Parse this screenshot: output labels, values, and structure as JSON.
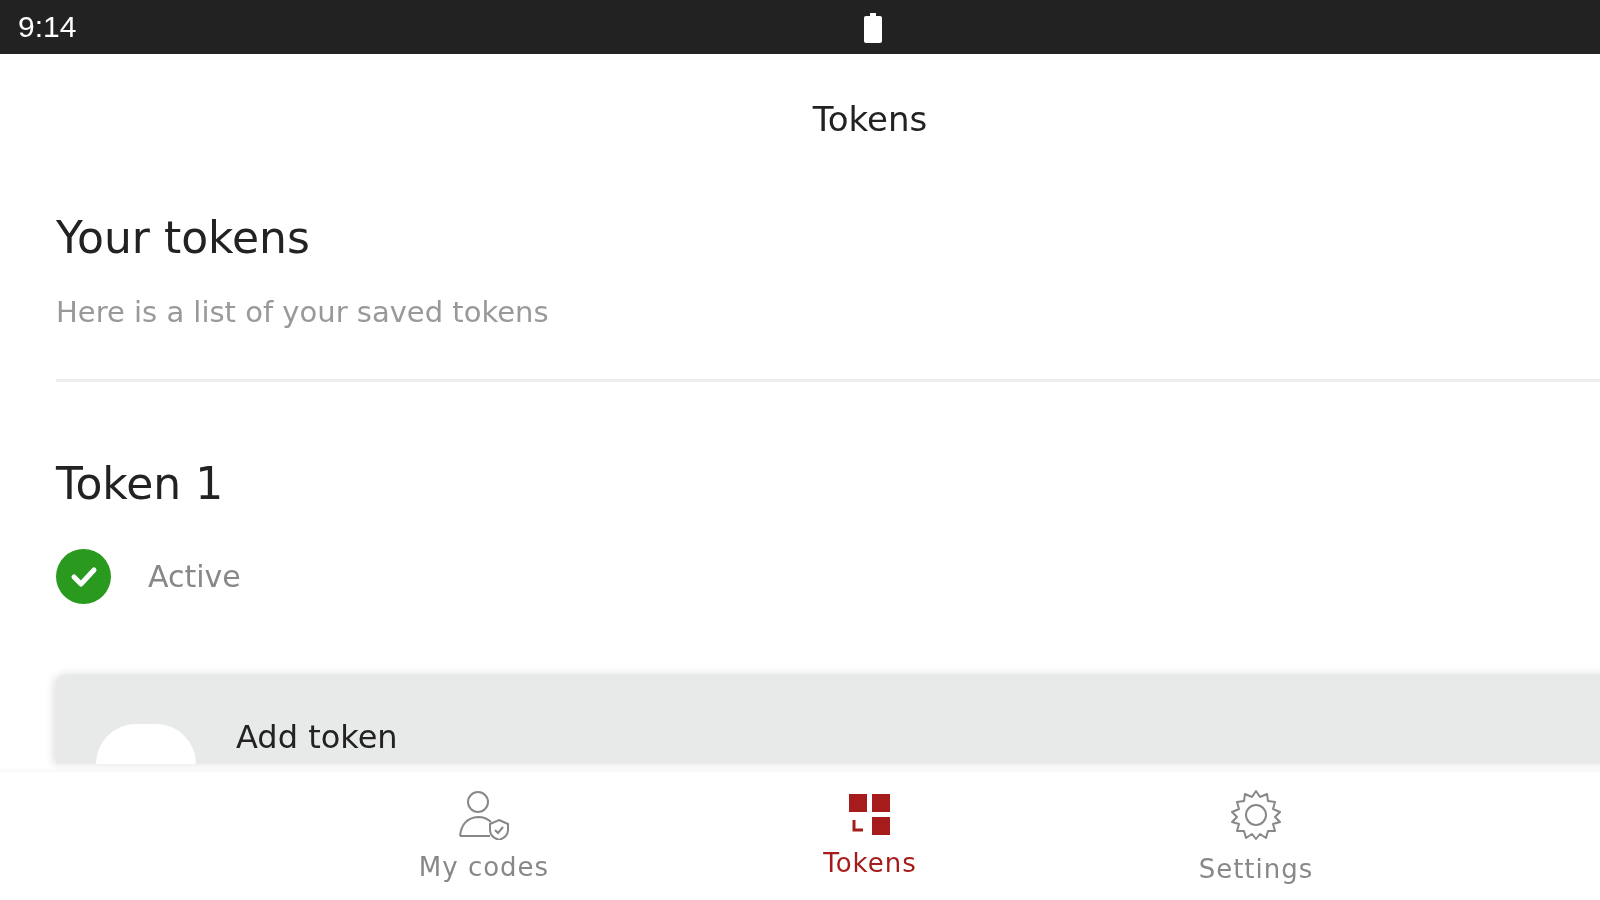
{
  "status_bar": {
    "time": "9:14"
  },
  "app_bar": {
    "title": "Tokens"
  },
  "header": {
    "title": "Your tokens",
    "subtitle": "Here is a list of your saved tokens"
  },
  "tokens": [
    {
      "name": "Token 1",
      "status": "Active",
      "active": true
    }
  ],
  "add_card": {
    "label": "Add token"
  },
  "nav": [
    {
      "label": "My codes",
      "kind": "codes",
      "selected": false
    },
    {
      "label": "Tokens",
      "kind": "tokens",
      "selected": true
    },
    {
      "label": "Settings",
      "kind": "settings",
      "selected": false
    }
  ]
}
